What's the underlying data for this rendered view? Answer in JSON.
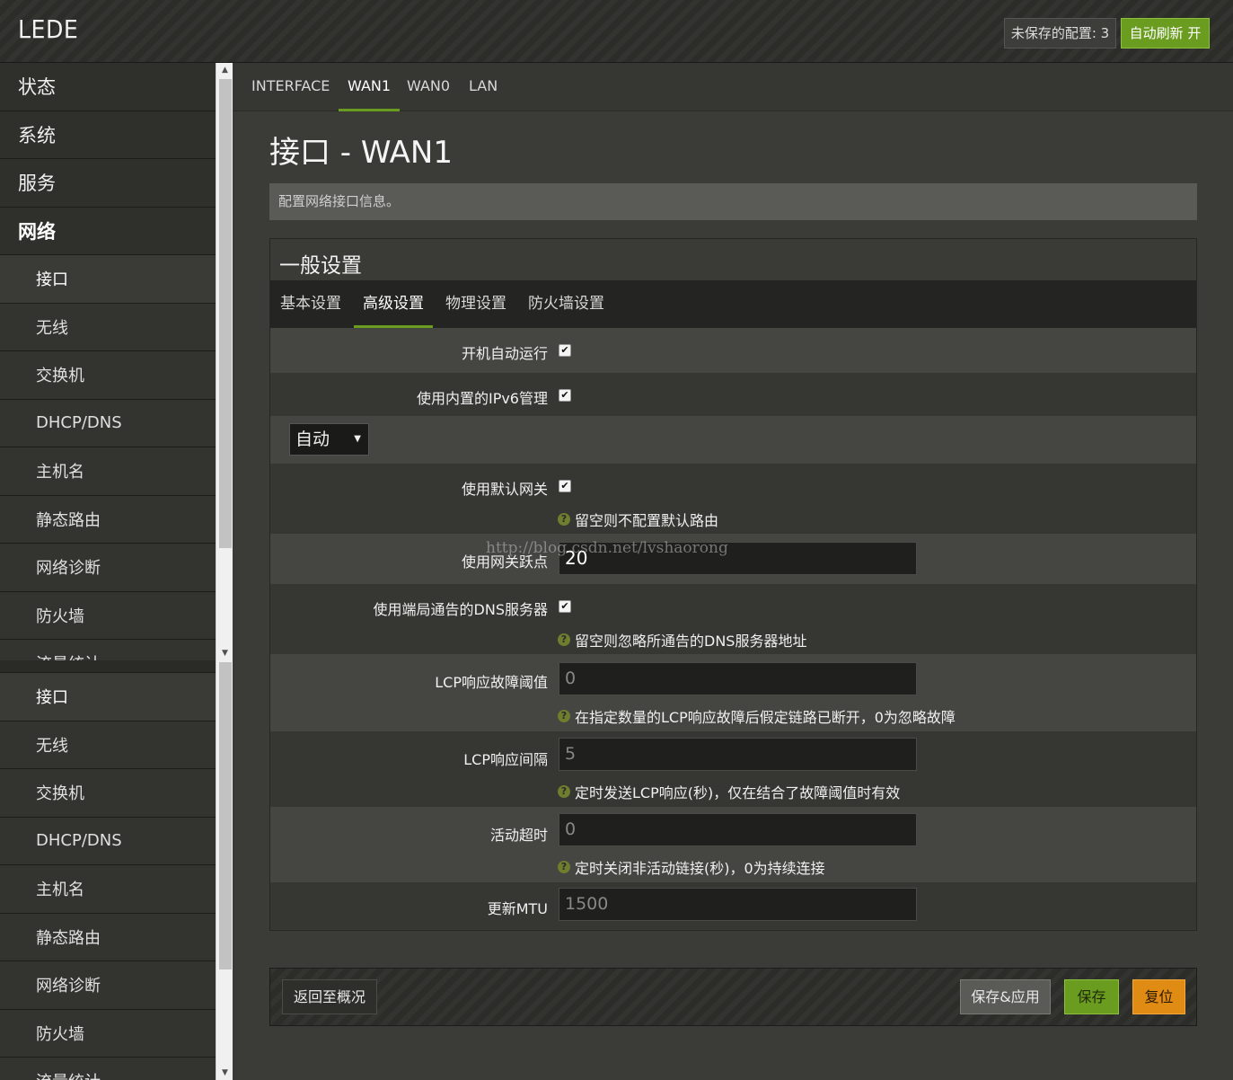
{
  "header": {
    "brand": "LEDE",
    "unsaved_label": "未保存的配置: 3",
    "autorefresh_label": "自动刷新 开"
  },
  "sidebar": {
    "top_items": [
      {
        "label": "状态"
      },
      {
        "label": "系统"
      },
      {
        "label": "服务"
      },
      {
        "label": "网络"
      }
    ],
    "sub_items": [
      {
        "label": "接口"
      },
      {
        "label": "无线"
      },
      {
        "label": "交换机"
      },
      {
        "label": "DHCP/DNS"
      },
      {
        "label": "主机名"
      },
      {
        "label": "静态路由"
      },
      {
        "label": "网络诊断"
      },
      {
        "label": "防火墙"
      },
      {
        "label": "流量统计"
      }
    ],
    "bottom_items": [
      {
        "label": "接口"
      },
      {
        "label": "无线"
      },
      {
        "label": "交换机"
      },
      {
        "label": "DHCP/DNS"
      },
      {
        "label": "主机名"
      },
      {
        "label": "静态路由"
      },
      {
        "label": "网络诊断"
      },
      {
        "label": "防火墙"
      },
      {
        "label": "流量统计"
      }
    ]
  },
  "tabs": [
    "INTERFACE",
    "WAN1",
    "WAN0",
    "LAN"
  ],
  "page": {
    "title": "接口 - WAN1",
    "description": "配置网络接口信息。"
  },
  "section": {
    "title": "一般设置",
    "subtabs": [
      "基本设置",
      "高级设置",
      "物理设置",
      "防火墙设置"
    ]
  },
  "form": {
    "autostart_label": "开机自动运行",
    "ipv6_label": "使用内置的IPv6管理",
    "select_value": "自动",
    "default_gw_label": "使用默认网关",
    "default_gw_help": "留空则不配置默认路由",
    "gw_metric_label": "使用网关跃点",
    "gw_metric_value": "20",
    "peer_dns_label": "使用端局通告的DNS服务器",
    "peer_dns_help": "留空则忽略所通告的DNS服务器地址",
    "lcp_fail_label": "LCP响应故障阈值",
    "lcp_fail_placeholder": "0",
    "lcp_fail_help": "在指定数量的LCP响应故障后假定链路已断开，0为忽略故障",
    "lcp_interval_label": "LCP响应间隔",
    "lcp_interval_placeholder": "5",
    "lcp_interval_help": "定时发送LCP响应(秒)，仅在结合了故障阈值时有效",
    "idle_label": "活动超时",
    "idle_placeholder": "0",
    "idle_help": "定时关闭非活动链接(秒)，0为持续连接",
    "mtu_label": "更新MTU",
    "mtu_placeholder": "1500"
  },
  "watermark": "http://blog.csdn.net/lvshaorong",
  "footer": {
    "back_label": "返回至概况",
    "save_apply_label": "保存&应用",
    "save_label": "保存",
    "reset_label": "复位"
  }
}
